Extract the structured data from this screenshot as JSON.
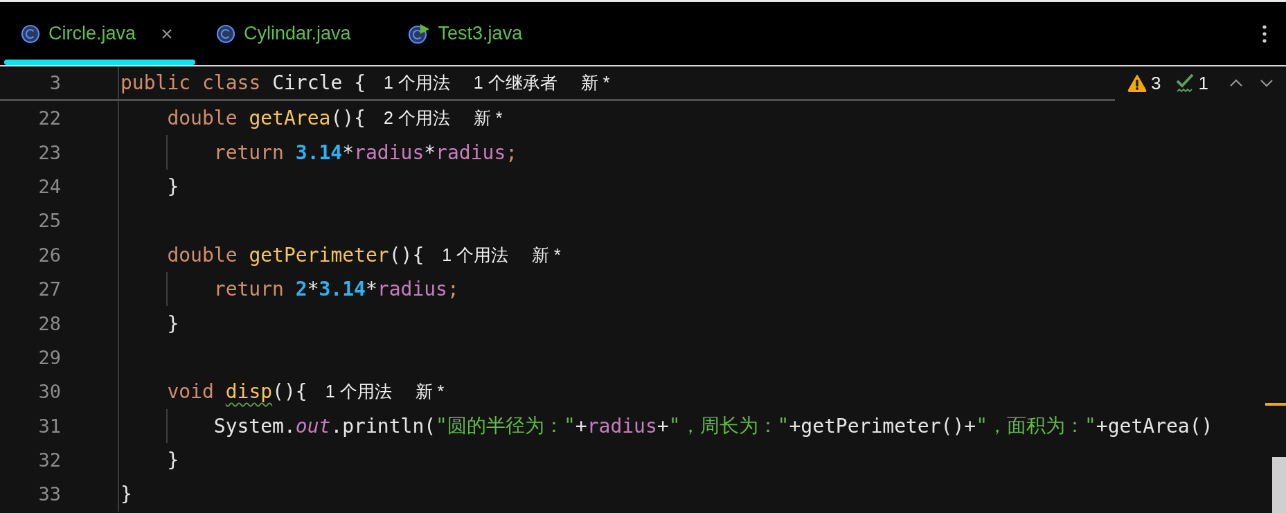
{
  "tabs": [
    {
      "label": "Circle.java",
      "selected": true,
      "closable": true,
      "kind": "class"
    },
    {
      "label": "Cylindar.java",
      "selected": false,
      "closable": false,
      "kind": "class"
    },
    {
      "label": "Test3.java",
      "selected": false,
      "closable": false,
      "kind": "runnable"
    }
  ],
  "editor": {
    "sticky_line": {
      "number": "3",
      "kind": "class",
      "tokens": [
        {
          "kind": "keyword",
          "text": "public",
          "weak_warning": false
        },
        {
          "kind": "keyword",
          "text": "class",
          "weak_warning": false
        },
        {
          "kind": "plain",
          "text": "Circle {",
          "weak_warning": false
        },
        {
          "kind": "hint",
          "text": "1 个用法",
          "weak_warning": false
        },
        {
          "kind": "hint",
          "text": "1 个继承者",
          "weak_warning": false
        },
        {
          "kind": "hint",
          "text": "新 *",
          "weak_warning": false
        }
      ]
    },
    "inspections": {
      "warnings": "3",
      "weak_warnings": "1"
    },
    "lines": [
      {
        "number": "22",
        "kind": "member",
        "tokens": [
          {
            "kind": "keyword",
            "text": "double",
            "weak_warning": false
          },
          {
            "kind": "method",
            "text": "getArea",
            "weak_warning": false
          },
          {
            "kind": "plain",
            "text": "(){",
            "weak_warning": false
          },
          {
            "kind": "hint",
            "text": "2 个用法",
            "weak_warning": false
          },
          {
            "kind": "hint",
            "text": "新 *",
            "weak_warning": false
          }
        ]
      },
      {
        "number": "23",
        "kind": "body",
        "tokens": [
          {
            "kind": "keyword",
            "text": "return",
            "weak_warning": false
          },
          {
            "kind": "number",
            "text": "3.14",
            "weak_warning": false
          },
          {
            "kind": "plain",
            "text": "*",
            "weak_warning": false
          },
          {
            "kind": "field",
            "text": "radius",
            "weak_warning": false
          },
          {
            "kind": "plain",
            "text": "*",
            "weak_warning": false
          },
          {
            "kind": "field",
            "text": "radius",
            "weak_warning": false
          },
          {
            "kind": "semicolon",
            "text": ";",
            "weak_warning": false
          }
        ]
      },
      {
        "number": "24",
        "kind": "member-end",
        "tokens": [
          {
            "kind": "plain",
            "text": "}",
            "weak_warning": false
          }
        ]
      },
      {
        "number": "25",
        "kind": "blank"
      },
      {
        "number": "26",
        "kind": "member",
        "tokens": [
          {
            "kind": "keyword",
            "text": "double",
            "weak_warning": false
          },
          {
            "kind": "method",
            "text": "getPerimeter",
            "weak_warning": false
          },
          {
            "kind": "plain",
            "text": "(){",
            "weak_warning": false
          },
          {
            "kind": "hint",
            "text": "1 个用法",
            "weak_warning": false
          },
          {
            "kind": "hint",
            "text": "新 *",
            "weak_warning": false
          }
        ]
      },
      {
        "number": "27",
        "kind": "body",
        "tokens": [
          {
            "kind": "keyword",
            "text": "return",
            "weak_warning": false
          },
          {
            "kind": "number",
            "text": "2",
            "weak_warning": false
          },
          {
            "kind": "plain",
            "text": "*",
            "weak_warning": false
          },
          {
            "kind": "number",
            "text": "3.14",
            "weak_warning": false
          },
          {
            "kind": "plain",
            "text": "*",
            "weak_warning": false
          },
          {
            "kind": "field",
            "text": "radius",
            "weak_warning": false
          },
          {
            "kind": "semicolon",
            "text": ";",
            "weak_warning": false
          }
        ]
      },
      {
        "number": "28",
        "kind": "member-end",
        "tokens": [
          {
            "kind": "plain",
            "text": "}",
            "weak_warning": false
          }
        ]
      },
      {
        "number": "29",
        "kind": "blank"
      },
      {
        "number": "30",
        "kind": "member",
        "tokens": [
          {
            "kind": "keyword",
            "text": "void",
            "weak_warning": false
          },
          {
            "kind": "method",
            "text": "disp",
            "weak_warning": true
          },
          {
            "kind": "plain",
            "text": "(){",
            "weak_warning": false
          },
          {
            "kind": "hint",
            "text": "1 个用法",
            "weak_warning": false
          },
          {
            "kind": "hint",
            "text": "新 *",
            "weak_warning": false
          }
        ]
      },
      {
        "number": "31",
        "kind": "body",
        "tokens": [
          {
            "kind": "plain",
            "text": "System.",
            "weak_warning": false
          },
          {
            "kind": "static",
            "text": "out",
            "weak_warning": false
          },
          {
            "kind": "plain",
            "text": ".println(",
            "weak_warning": false
          },
          {
            "kind": "string",
            "text": "\"圆的半径为：\"",
            "weak_warning": false
          },
          {
            "kind": "plain",
            "text": "+",
            "weak_warning": false
          },
          {
            "kind": "field",
            "text": "radius",
            "weak_warning": false
          },
          {
            "kind": "plain",
            "text": "+",
            "weak_warning": false
          },
          {
            "kind": "string",
            "text": "\"，周长为：\"",
            "weak_warning": false
          },
          {
            "kind": "plain",
            "text": "+getPerimeter()+",
            "weak_warning": false
          },
          {
            "kind": "string",
            "text": "\"，面积为：\"",
            "weak_warning": false
          },
          {
            "kind": "plain",
            "text": "+getArea()",
            "weak_warning": false
          }
        ]
      },
      {
        "number": "32",
        "kind": "member-end",
        "tokens": [
          {
            "kind": "plain",
            "text": "}",
            "weak_warning": false
          }
        ]
      },
      {
        "number": "33",
        "kind": "class-end",
        "tokens": [
          {
            "kind": "plain",
            "text": "}",
            "weak_warning": false
          }
        ]
      }
    ]
  }
}
